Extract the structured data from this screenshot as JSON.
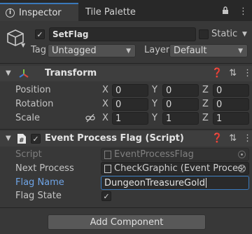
{
  "tabs": {
    "inspector": "Inspector",
    "tile_palette": "Tile Palette"
  },
  "object": {
    "name": "SetFlag",
    "active": true,
    "static_label": "Static",
    "tag_label": "Tag",
    "tag_value": "Untagged",
    "layer_label": "Layer",
    "layer_value": "Default"
  },
  "transform": {
    "title": "Transform",
    "rows": [
      {
        "label": "Position",
        "x": "0",
        "y": "0",
        "z": "0"
      },
      {
        "label": "Rotation",
        "x": "0",
        "y": "0",
        "z": "0"
      },
      {
        "label": "Scale",
        "x": "1",
        "y": "1",
        "z": "1"
      }
    ],
    "axes": {
      "x": "X",
      "y": "Y",
      "z": "Z"
    }
  },
  "script_component": {
    "title": "Event Process Flag (Script)",
    "enabled": true,
    "script_label": "Script",
    "script_value": "EventProcessFlag",
    "next_process_label": "Next Process",
    "next_process_value": "CheckGraphic (Event Process (",
    "flag_name_label": "Flag Name",
    "flag_name_value": "DungeonTreasureGold",
    "flag_state_label": "Flag State",
    "flag_state_checked": true
  },
  "add_component_label": "Add Component",
  "colors": {
    "accent": "#3a79bb",
    "highlight_label": "#6fa4e6",
    "panel_bg": "#383838"
  }
}
